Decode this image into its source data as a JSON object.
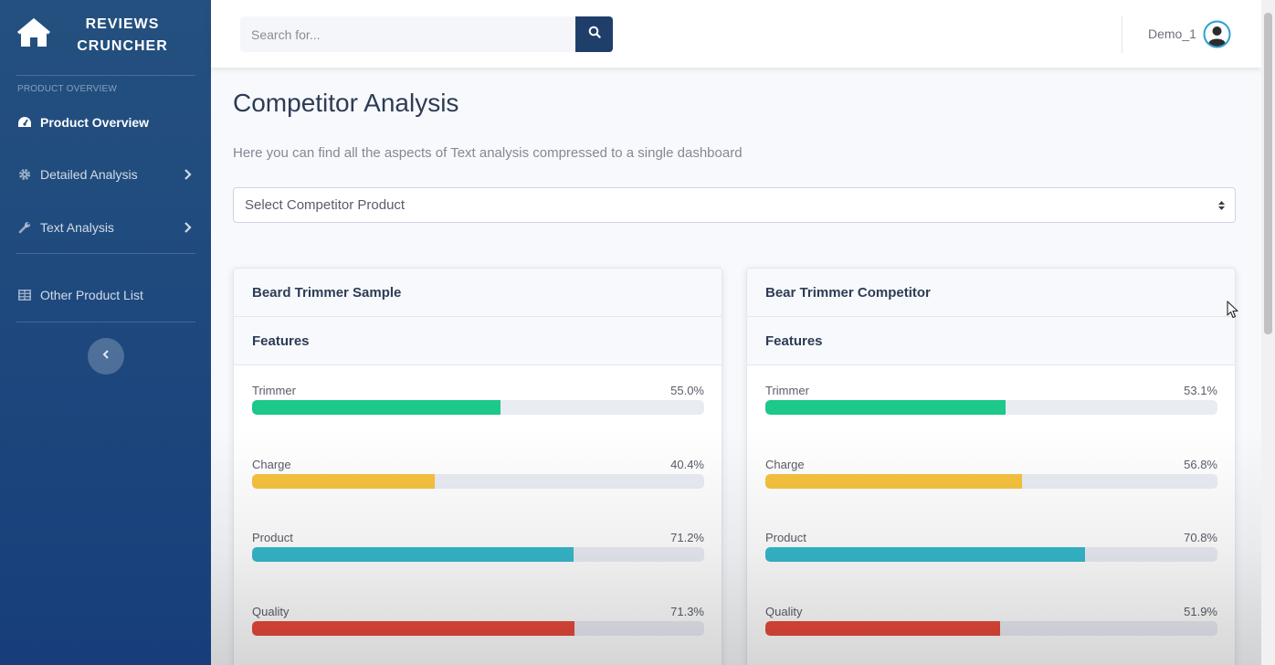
{
  "brand": {
    "line1": "REVIEWS",
    "line2": "CRUNCHER",
    "icon": "home-icon"
  },
  "sidebar": {
    "heading": "PRODUCT OVERVIEW",
    "items": [
      {
        "label": "Product Overview",
        "icon": "tachometer-icon",
        "active": true
      },
      {
        "label": "Detailed Analysis",
        "icon": "gear-icon",
        "has_chevron": true
      },
      {
        "label": "Text Analysis",
        "icon": "wrench-icon",
        "has_chevron": true
      },
      {
        "label": "Other Product List",
        "icon": "table-icon"
      }
    ],
    "toggle_icon": "chevron-left-icon"
  },
  "topbar": {
    "search_placeholder": "Search for...",
    "search_icon": "search-icon",
    "user_name": "Demo_1",
    "avatar_icon": "user-circle-icon"
  },
  "main": {
    "title": "Competitor Analysis",
    "subtitle": "Here you can find all the aspects of Text analysis compressed to a single dashboard",
    "select_label": "Select Competitor Product"
  },
  "colors": {
    "sidebar": "#1f4a7e",
    "trimmer": "#1cc88a",
    "charge": "#f6c23e",
    "product": "#36b9cc",
    "quality": "#e74a3b"
  },
  "cards": [
    {
      "title": "Beard Trimmer Sample",
      "section": "Features",
      "features": [
        {
          "name": "Trimmer",
          "pct_label": "55.0%",
          "value": 55.0,
          "color": "#1cc88a"
        },
        {
          "name": "Charge",
          "pct_label": "40.4%",
          "value": 40.4,
          "color": "#f6c23e"
        },
        {
          "name": "Product",
          "pct_label": "71.2%",
          "value": 71.2,
          "color": "#36b9cc"
        },
        {
          "name": "Quality",
          "pct_label": "71.3%",
          "value": 71.3,
          "color": "#e74a3b"
        }
      ]
    },
    {
      "title": "Bear Trimmer Competitor",
      "section": "Features",
      "features": [
        {
          "name": "Trimmer",
          "pct_label": "53.1%",
          "value": 53.1,
          "color": "#1cc88a"
        },
        {
          "name": "Charge",
          "pct_label": "56.8%",
          "value": 56.8,
          "color": "#f6c23e"
        },
        {
          "name": "Product",
          "pct_label": "70.8%",
          "value": 70.8,
          "color": "#36b9cc"
        },
        {
          "name": "Quality",
          "pct_label": "51.9%",
          "value": 51.9,
          "color": "#e74a3b"
        }
      ]
    }
  ]
}
